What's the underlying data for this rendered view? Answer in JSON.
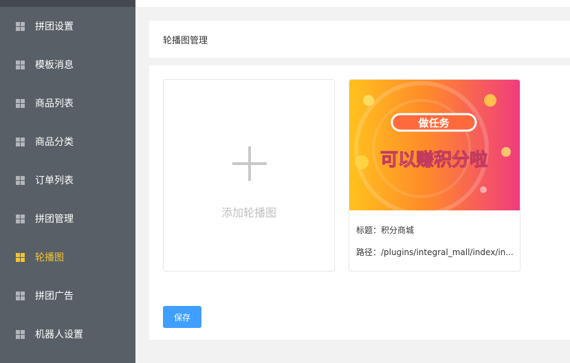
{
  "sidebar": {
    "items": [
      {
        "label": "拼团设置",
        "active": false
      },
      {
        "label": "模板消息",
        "active": false
      },
      {
        "label": "商品列表",
        "active": false
      },
      {
        "label": "商品分类",
        "active": false
      },
      {
        "label": "订单列表",
        "active": false
      },
      {
        "label": "拼团管理",
        "active": false
      },
      {
        "label": "轮播图",
        "active": true
      },
      {
        "label": "拼团广告",
        "active": false
      },
      {
        "label": "机器人设置",
        "active": false
      }
    ]
  },
  "header": {
    "title": "轮播图管理"
  },
  "add_card": {
    "label": "添加轮播图"
  },
  "banner": {
    "image_title": "做任务",
    "image_subtitle": "可以赚积分啦",
    "title_line": "标题：积分商城",
    "path_line": "路径：/plugins/integral_mall/index/in..."
  },
  "save_label": "保存",
  "colors": {
    "accent": "#409eff",
    "sidebar": "#585f66",
    "active": "#f4c430"
  }
}
